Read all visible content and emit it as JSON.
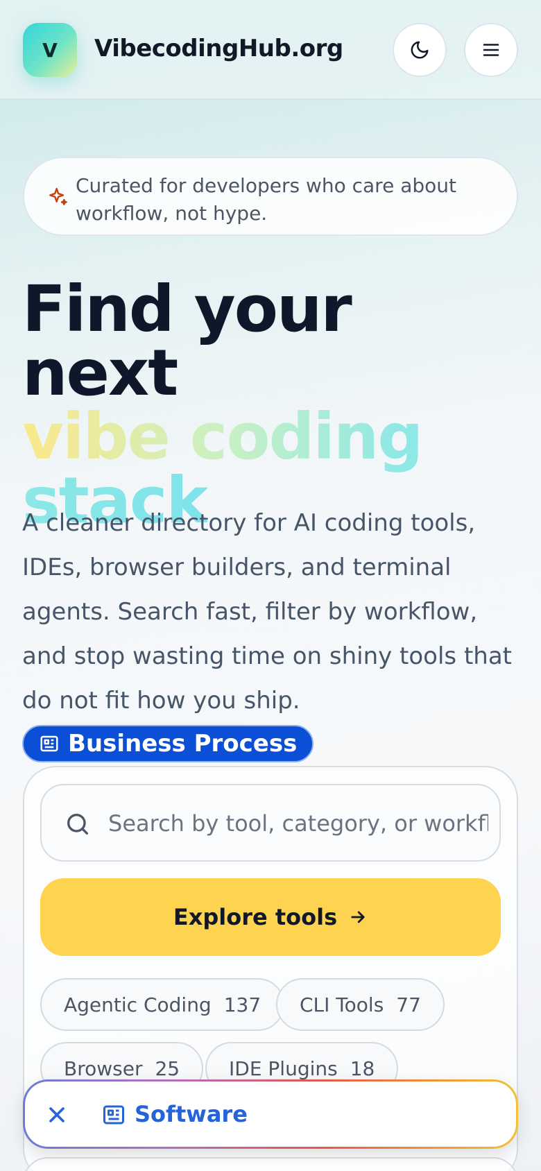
{
  "header": {
    "logo_letter": "V",
    "brand": "VibecodingHub.org",
    "theme_toggle_icon": "moon-icon",
    "menu_icon": "hamburger-menu-icon"
  },
  "hero": {
    "note": "Curated for developers who care about workflow, not hype.",
    "note_icon": "sparkle-icon",
    "headline_line1": "Find your next",
    "headline_highlight": "vibe coding stack",
    "lead": "A cleaner directory for AI coding tools, IDEs, browser builders, and terminal agents. Search fast, filter by workflow, and stop wasting time on shiny tools that do not fit how you ship.",
    "badge_label": "Business Process"
  },
  "search": {
    "placeholder": "Search by tool, category, or workflow..."
  },
  "explore_button": {
    "label": "Explore tools"
  },
  "categories": [
    {
      "label": "Agentic Coding",
      "count": "137"
    },
    {
      "label": "CLI Tools",
      "count": "77"
    },
    {
      "label": "Browser",
      "count": "25"
    },
    {
      "label": "IDE Plugins",
      "count": "18"
    }
  ],
  "toast": {
    "label": "Software"
  },
  "colors": {
    "accent_yellow": "#fdd34f",
    "badge_blue": "#0b4fd6",
    "toast_text_blue": "#2563d8"
  }
}
